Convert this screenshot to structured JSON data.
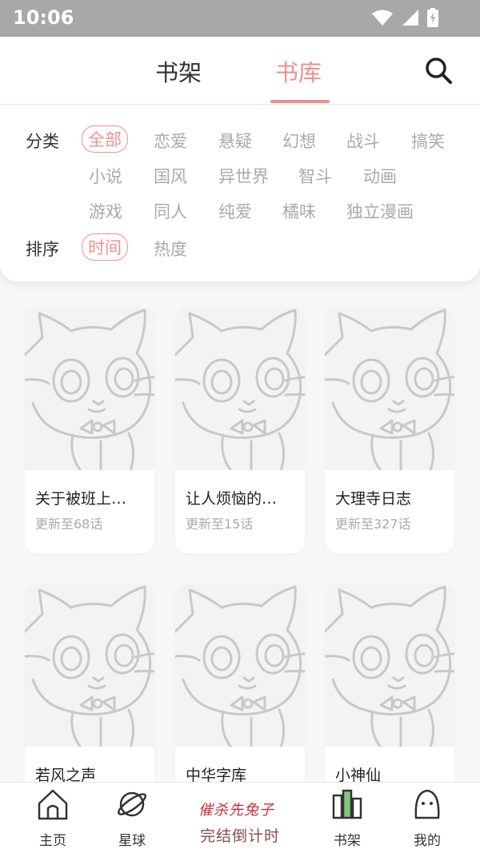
{
  "status_bar": {
    "time": "10:06"
  },
  "header": {
    "tabs": [
      {
        "label": "书架",
        "active": false
      },
      {
        "label": "书库",
        "active": true
      }
    ],
    "accent_color": "#f08f8f"
  },
  "filters": {
    "category": {
      "label": "分类",
      "options": [
        "全部",
        "恋爱",
        "悬疑",
        "幻想",
        "战斗",
        "搞笑",
        "小说",
        "国风",
        "异世界",
        "智斗",
        "动画",
        "游戏",
        "同人",
        "纯爱",
        "橘味",
        "独立漫画"
      ],
      "selected": "全部"
    },
    "sort": {
      "label": "排序",
      "options": [
        "时间",
        "热度"
      ],
      "selected": "时间"
    }
  },
  "books": [
    {
      "title": "关于被班上…",
      "update": "更新至68话"
    },
    {
      "title": "让人烦恼的…",
      "update": "更新至15话"
    },
    {
      "title": "大理寺日志",
      "update": "更新至327话"
    },
    {
      "title": "若风之声",
      "update": ""
    },
    {
      "title": "中华字库",
      "update": ""
    },
    {
      "title": "小神仙",
      "update": ""
    }
  ],
  "bottom_nav": {
    "items": [
      {
        "label": "主页",
        "icon": "home-icon"
      },
      {
        "label": "星球",
        "icon": "planet-icon"
      },
      {
        "label": "书架",
        "icon": "bookshelf-icon"
      },
      {
        "label": "我的",
        "icon": "profile-icon"
      }
    ],
    "promo": {
      "top_text": "催杀先兔子",
      "bottom_text": "完结倒计时"
    }
  }
}
